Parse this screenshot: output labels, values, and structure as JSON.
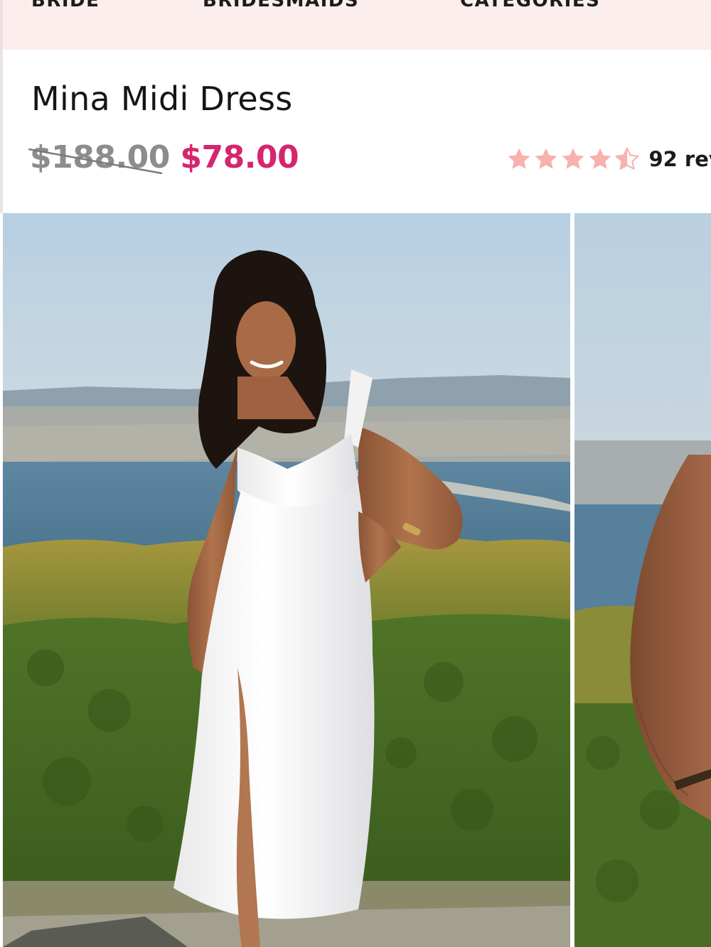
{
  "nav": {
    "items": [
      {
        "label": "BRIDE"
      },
      {
        "label": "BRIDESMAIDS"
      },
      {
        "label": "CATEGORIES"
      }
    ]
  },
  "product": {
    "title": "Mina Midi Dress",
    "original_price": "$188.00",
    "sale_price": "$78.00",
    "rating": 4.5,
    "reviews_label": "92 rev"
  },
  "gallery": {
    "images": [
      {
        "description": "model-white-satin-midi-dress-front"
      },
      {
        "description": "model-white-satin-midi-dress-partial"
      }
    ]
  },
  "colors": {
    "nav_background": "#fbeeed",
    "sale_price": "#d6256f",
    "original_price": "#8c8c8c",
    "star": "#f6b2ad"
  },
  "icons": {
    "star_full": "star-icon",
    "star_half": "star-half-icon"
  }
}
